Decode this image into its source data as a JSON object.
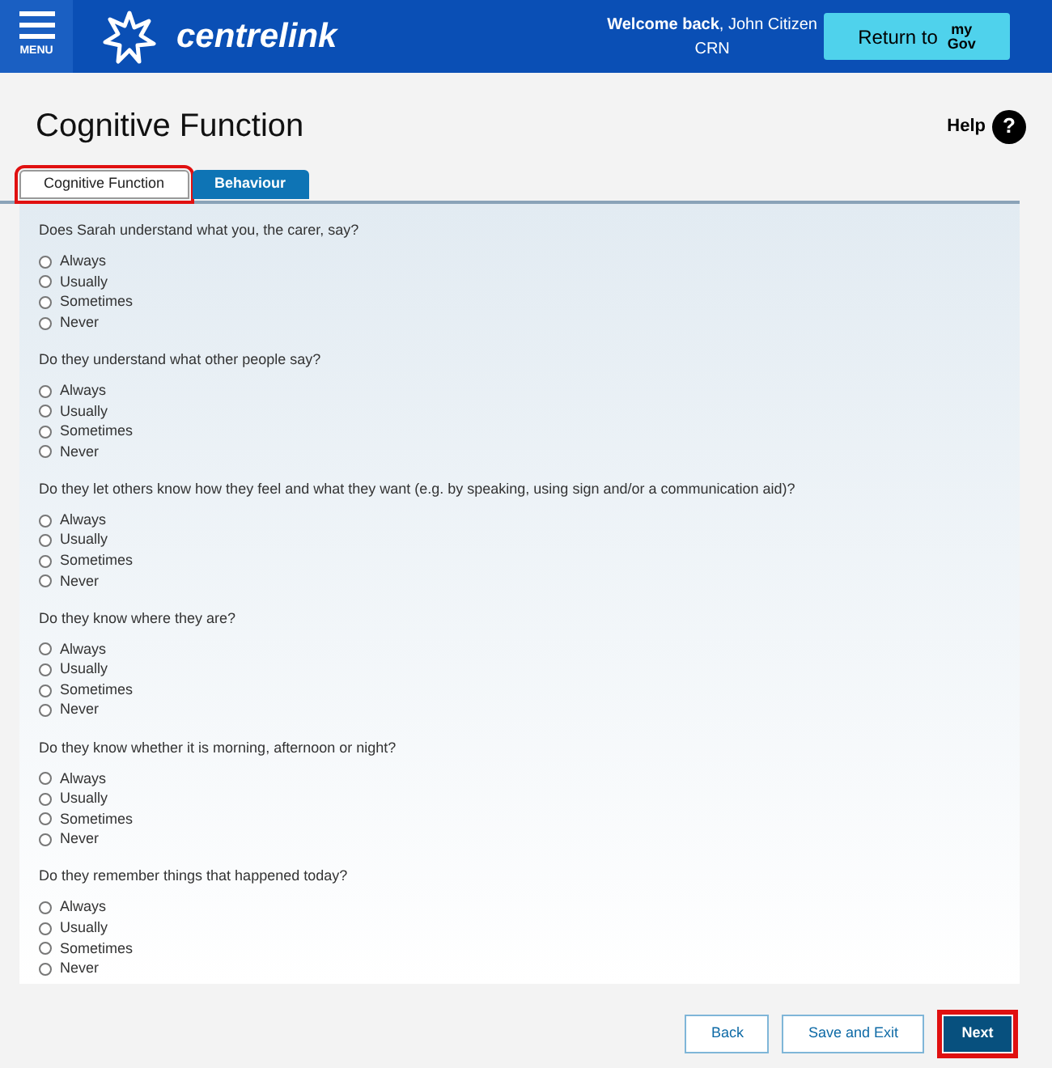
{
  "header": {
    "menu_label": "MENU",
    "logo_text": "centrelink",
    "welcome": "**Welcome back**, John Citizen",
    "crn": "CRN",
    "return_button": {
      "label": "Return to",
      "brand_top": "my",
      "brand_bottom": "Gov"
    }
  },
  "page": {
    "title": "Cognitive Function",
    "help": "Help",
    "help_icon": "?"
  },
  "tabs": [
    {
      "label": "Cognitive Function",
      "selected": true,
      "highlighted": true
    },
    {
      "label": "Behaviour",
      "selected": false,
      "highlighted": false
    }
  ],
  "questions": [
    {
      "text": "Does Sarah understand what you, the carer, say?",
      "options": [
        {
          "label": "Always",
          "selected": false
        },
        {
          "label": "Usually",
          "selected": false
        },
        {
          "label": "Sometimes",
          "selected": false
        },
        {
          "label": "Never",
          "selected": false
        }
      ]
    },
    {
      "text": "Do they understand what other people say?",
      "options": [
        {
          "label": "Always",
          "selected": false
        },
        {
          "label": "Usually",
          "selected": false
        },
        {
          "label": "Sometimes",
          "selected": false
        },
        {
          "label": "Never",
          "selected": false
        }
      ]
    },
    {
      "text": "Do they let others know how they feel and what they want (e.g. by speaking, using sign and/or a communication aid)?",
      "options": [
        {
          "label": "Always",
          "selected": false
        },
        {
          "label": "Usually",
          "selected": false
        },
        {
          "label": "Sometimes",
          "selected": false
        },
        {
          "label": "Never",
          "selected": false
        }
      ]
    },
    {
      "text": "Do they know where they are?",
      "options": [
        {
          "label": "Always",
          "selected": false
        },
        {
          "label": "Usually",
          "selected": false
        },
        {
          "label": "Sometimes",
          "selected": false
        },
        {
          "label": "Never",
          "selected": false
        }
      ]
    },
    {
      "text": "Do they know whether it is morning, afternoon or night?",
      "options": [
        {
          "label": "Always",
          "selected": false
        },
        {
          "label": "Usually",
          "selected": false
        },
        {
          "label": "Sometimes",
          "selected": false
        },
        {
          "label": "Never",
          "selected": false
        }
      ]
    },
    {
      "text": "Do they remember things that happened today?",
      "options": [
        {
          "label": "Always",
          "selected": false
        },
        {
          "label": "Usually",
          "selected": false
        },
        {
          "label": "Sometimes",
          "selected": false
        },
        {
          "label": "Never",
          "selected": false
        }
      ]
    }
  ],
  "buttons": [
    {
      "label": "Back",
      "kind": "secondary",
      "highlighted": false
    },
    {
      "label": "Save and Exit",
      "kind": "secondary",
      "highlighted": false
    },
    {
      "label": "Next",
      "kind": "primary",
      "highlighted": true
    }
  ]
}
